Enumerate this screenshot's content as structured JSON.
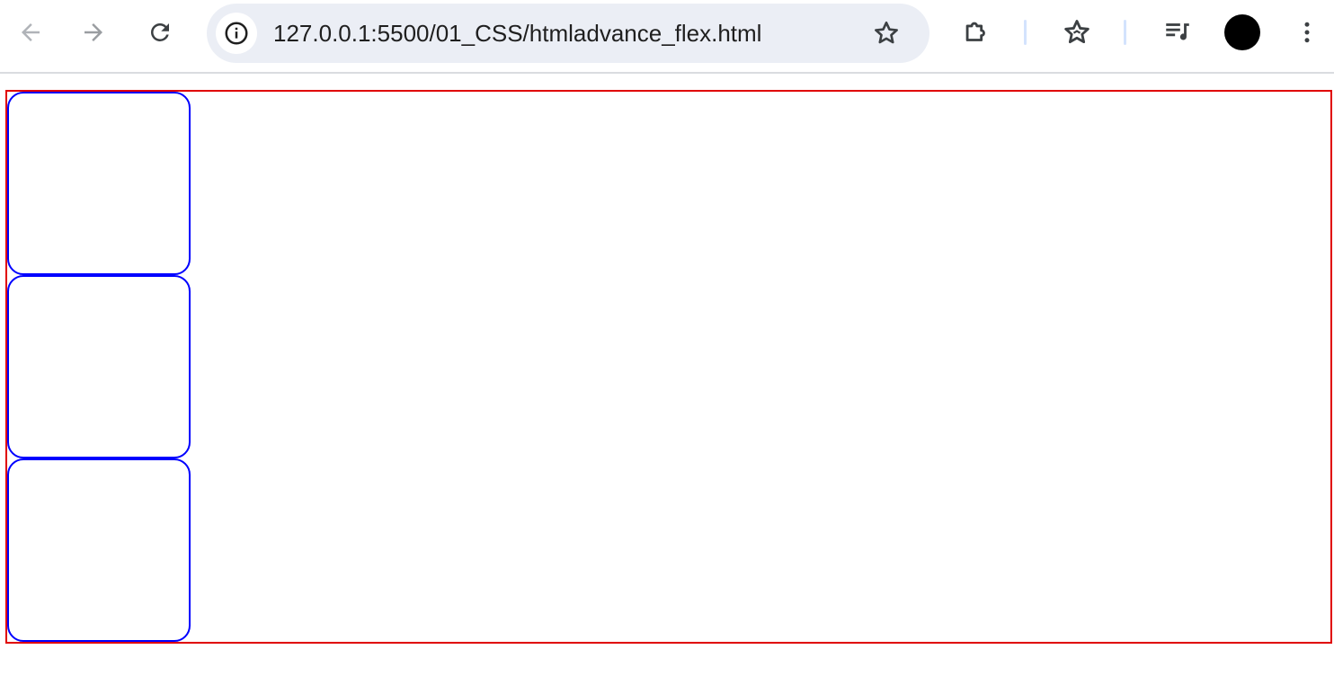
{
  "browser": {
    "url": "127.0.0.1:5500/01_CSS/htmladvance_flex.html",
    "icons": {
      "back": "arrow-left-icon",
      "forward": "arrow-right-icon",
      "reload": "reload-icon",
      "site_info": "info-icon",
      "bookmark": "star-icon",
      "extensions": "puzzle-icon",
      "reading_list": "star-list-icon",
      "media": "playlist-icon",
      "profile": "avatar",
      "menu": "kebab-menu-icon"
    }
  },
  "page": {
    "container_border_color": "#e00000",
    "item_border_color": "#0000ff",
    "items": [
      {},
      {},
      {}
    ]
  }
}
